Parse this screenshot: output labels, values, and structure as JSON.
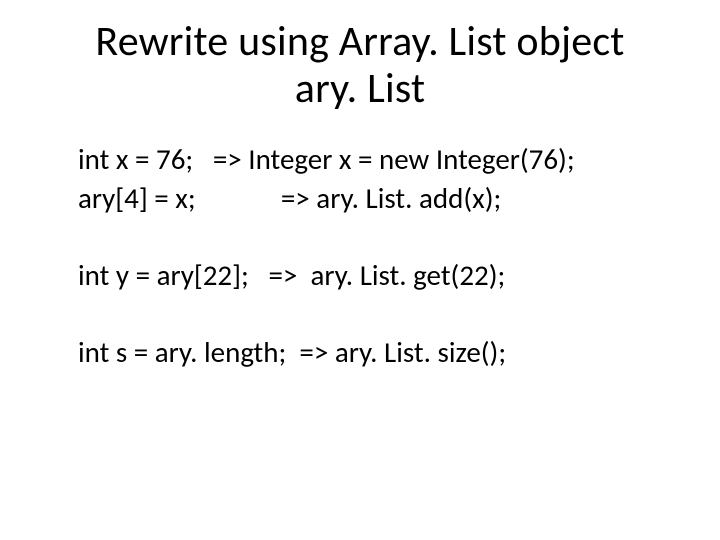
{
  "title_line1": "Rewrite using Array. List object",
  "title_line2": "ary. List",
  "lines": {
    "l1": "int x = 76;   => Integer x = new Integer(76);",
    "l2": "ary[4] = x;             => ary. List. add(x);",
    "l3": "int y = ary[22];   =>  ary. List. get(22);",
    "l4": "int s = ary. length;  => ary. List. size();"
  }
}
